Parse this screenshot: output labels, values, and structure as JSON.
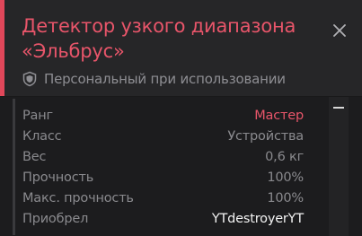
{
  "item": {
    "title": "Детектор узкого диапазона «Эльбрус»",
    "binding": "Персональный при использовании"
  },
  "icons": {
    "close": "close-icon",
    "binding": "shield-icon"
  },
  "colors": {
    "accent": "#e0475a",
    "title": "#e8556a",
    "rank_value": "#e8556a",
    "owner_value": "#f2f2f2",
    "muted": "#8a8a8e",
    "panel_bg": "#1d1d1f",
    "header_bg": "#262628"
  },
  "stats": {
    "rank": {
      "label": "Ранг",
      "value": "Мастер"
    },
    "class": {
      "label": "Класс",
      "value": "Устройства"
    },
    "weight": {
      "label": "Вес",
      "value": "0,6 кг"
    },
    "durability": {
      "label": "Прочность",
      "value": "100%"
    },
    "max_durability": {
      "label": "Макс. прочность",
      "value": "100%"
    },
    "acquired": {
      "label": "Приобрел",
      "value": "YTdestroyerYT"
    }
  }
}
